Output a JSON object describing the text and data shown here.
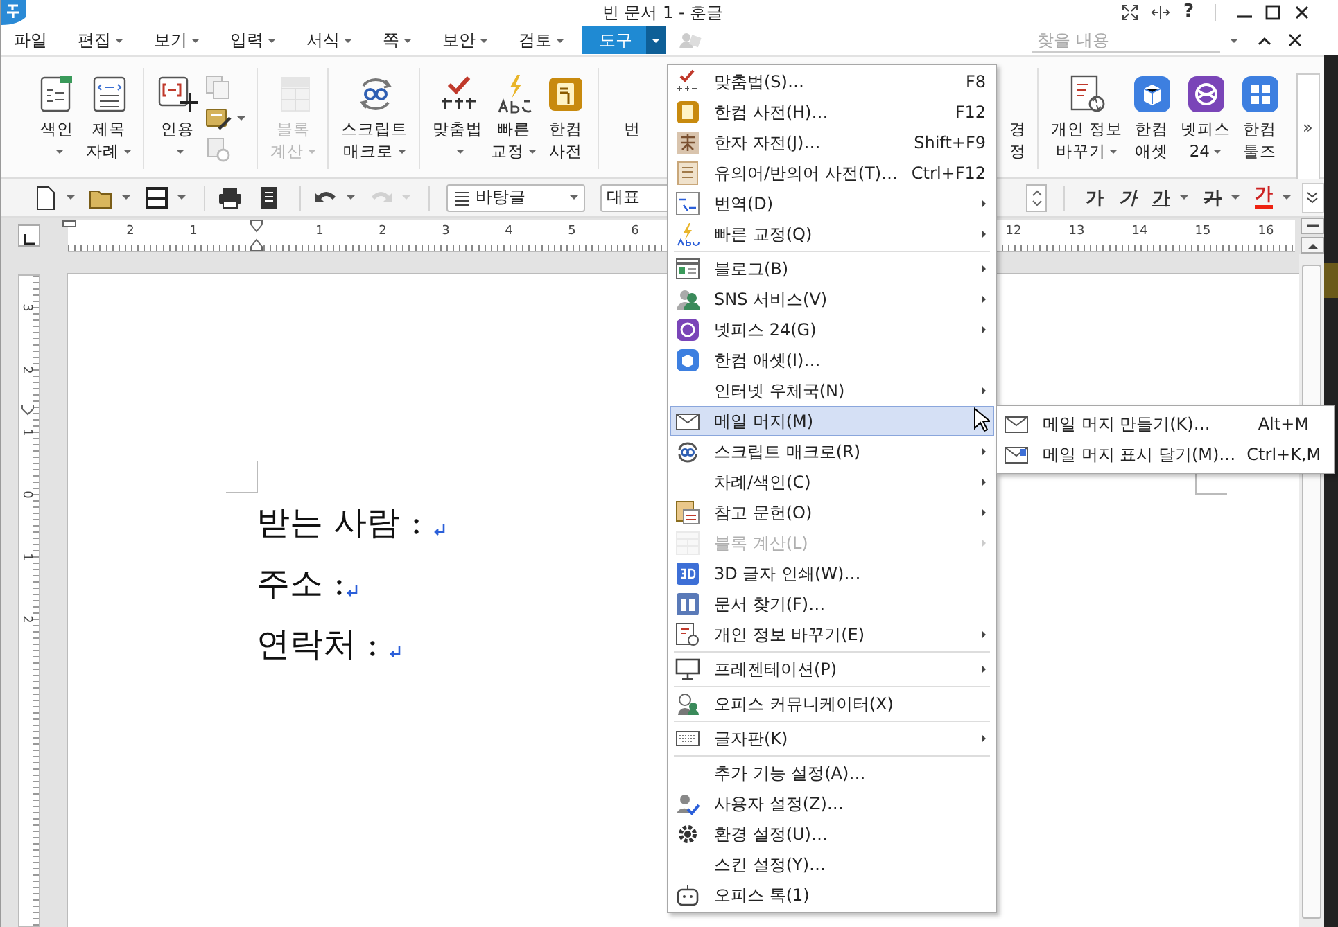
{
  "window": {
    "title": "빈 문서 1 - 훈글",
    "help_label": "?"
  },
  "menubar": {
    "items": [
      {
        "label": "파일",
        "dropdown": false,
        "selected": false
      },
      {
        "label": "편집",
        "dropdown": true,
        "selected": false
      },
      {
        "label": "보기",
        "dropdown": true,
        "selected": false
      },
      {
        "label": "입력",
        "dropdown": true,
        "selected": false
      },
      {
        "label": "서식",
        "dropdown": true,
        "selected": false
      },
      {
        "label": "쪽",
        "dropdown": true,
        "selected": false
      },
      {
        "label": "보안",
        "dropdown": true,
        "selected": false
      },
      {
        "label": "검토",
        "dropdown": true,
        "selected": false
      },
      {
        "label": "도구",
        "dropdown": true,
        "selected": true
      }
    ],
    "search": {
      "placeholder": "찾을 내용"
    }
  },
  "ribbon": {
    "left": [
      {
        "kind": "large",
        "label": [
          "색인"
        ],
        "dropdown": true,
        "disabled": false,
        "separator_after": false
      },
      {
        "kind": "large",
        "label": [
          "제목",
          "자례"
        ],
        "dropdown": true,
        "disabled": false,
        "separator_after": true
      },
      {
        "kind": "large",
        "label": [
          "인용"
        ],
        "dropdown": true,
        "disabled": false,
        "separator_after": false
      },
      {
        "kind": "stack",
        "dropdown": true,
        "disabled": false,
        "separator_after": true
      },
      {
        "kind": "large",
        "label": [
          "블록",
          "계산"
        ],
        "dropdown": true,
        "disabled": true,
        "separator_after": true
      },
      {
        "kind": "large",
        "label": [
          "스크립트",
          "매크로"
        ],
        "dropdown": true,
        "disabled": false,
        "separator_after": true
      },
      {
        "kind": "large",
        "label": [
          "맞춤법"
        ],
        "dropdown": true,
        "disabled": false,
        "separator_after": false
      },
      {
        "kind": "large",
        "label": [
          "빠른",
          "교정"
        ],
        "dropdown": true,
        "disabled": false,
        "separator_after": false
      },
      {
        "kind": "large",
        "label": [
          "한컴",
          "사전"
        ],
        "dropdown": false,
        "disabled": false,
        "separator_after": true
      },
      {
        "kind": "large",
        "label": [
          "번"
        ],
        "dropdown": false,
        "disabled": false
      }
    ],
    "right": [
      {
        "kind": "large",
        "label": [
          "경",
          "정"
        ],
        "dropdown": false,
        "disabled": false,
        "separator_after": true
      },
      {
        "kind": "large",
        "label": [
          "개인 정보",
          "바꾸기"
        ],
        "dropdown": true,
        "disabled": false,
        "separator_after": false
      },
      {
        "kind": "large",
        "label": [
          "한컴",
          "애셋"
        ],
        "dropdown": false,
        "disabled": false,
        "separator_after": false
      },
      {
        "kind": "large",
        "label": [
          "넷피스",
          "24"
        ],
        "dropdown": true,
        "disabled": false,
        "separator_after": false
      },
      {
        "kind": "large",
        "label": [
          "한컴",
          "툴즈"
        ],
        "dropdown": false,
        "disabled": false,
        "separator_after": false
      }
    ],
    "overflow": "»"
  },
  "toolbar": {
    "buttons": [
      {
        "kind": "new",
        "dropdown": true,
        "disabled": false
      },
      {
        "kind": "open",
        "dropdown": true,
        "disabled": false
      },
      {
        "kind": "save",
        "dropdown": true,
        "disabled": false
      },
      {
        "kind": "print",
        "dropdown": false,
        "disabled": false
      },
      {
        "kind": "preview",
        "dropdown": false,
        "disabled": false
      },
      {
        "kind": "undo",
        "dropdown": true,
        "disabled": false
      },
      {
        "kind": "redo",
        "dropdown": true,
        "disabled": true
      }
    ],
    "style_select": {
      "value": "바탕글"
    },
    "font_select": {
      "value": "대표"
    },
    "format_buttons": [
      {
        "kind": "bold",
        "label": "가",
        "dropdown": false
      },
      {
        "kind": "italic",
        "label": "가",
        "dropdown": false
      },
      {
        "kind": "underline",
        "label": "가",
        "dropdown": true
      },
      {
        "kind": "strike",
        "label": "가",
        "dropdown": true
      },
      {
        "kind": "color",
        "label": "가",
        "dropdown": true
      }
    ]
  },
  "ruler": {
    "left_numbers": [
      "2",
      "1"
    ],
    "right_numbers": [
      "1",
      "2",
      "3",
      "4",
      "5",
      "6"
    ],
    "far_numbers": [
      "12",
      "13",
      "14",
      "15",
      "16"
    ],
    "vertical_numbers": [
      "3",
      "2",
      "1",
      "0",
      "1",
      "2"
    ]
  },
  "document": {
    "lines": [
      "받는 사람 : ",
      "주소 :",
      "연락처 : "
    ]
  },
  "menu": {
    "items": [
      {
        "label": "맞춤법(S)…",
        "shortcut": "F8",
        "arrow": false,
        "selected": false,
        "disabled": false,
        "separator_after": false
      },
      {
        "label": "한컴 사전(H)…",
        "shortcut": "F12",
        "arrow": false,
        "selected": false,
        "disabled": false,
        "separator_after": false
      },
      {
        "label": "한자 자전(J)…",
        "shortcut": "Shift+F9",
        "arrow": false,
        "selected": false,
        "disabled": false,
        "separator_after": false
      },
      {
        "label": "유의어/반의어 사전(T)…",
        "shortcut": "Ctrl+F12",
        "arrow": false,
        "selected": false,
        "disabled": false,
        "separator_after": false
      },
      {
        "label": "번역(D)",
        "arrow": true,
        "selected": false,
        "disabled": false,
        "separator_after": false
      },
      {
        "label": "빠른 교정(Q)",
        "arrow": true,
        "selected": false,
        "disabled": false,
        "separator_after": true
      },
      {
        "label": "블로그(B)",
        "arrow": true,
        "selected": false,
        "disabled": false,
        "separator_after": false
      },
      {
        "label": "SNS 서비스(V)",
        "arrow": true,
        "selected": false,
        "disabled": false,
        "separator_after": false
      },
      {
        "label": "넷피스 24(G)",
        "arrow": true,
        "selected": false,
        "disabled": false,
        "separator_after": false
      },
      {
        "label": "한컴 애셋(I)…",
        "arrow": false,
        "selected": false,
        "disabled": false,
        "separator_after": false
      },
      {
        "label": "인터넷 우체국(N)",
        "arrow": true,
        "selected": false,
        "disabled": false,
        "separator_after": false
      },
      {
        "label": "메일 머지(M)",
        "arrow": true,
        "selected": true,
        "disabled": false,
        "separator_after": false,
        "submenu": [
          {
            "label": "메일 머지 만들기(K)…",
            "shortcut": "Alt+M",
            "selected": false
          },
          {
            "label": "메일 머지 표시 달기(M)…",
            "shortcut": "Ctrl+K,M",
            "selected": false
          }
        ]
      },
      {
        "label": "스크립트 매크로(R)",
        "arrow": true,
        "selected": false,
        "disabled": false,
        "separator_after": false
      },
      {
        "label": "차례/색인(C)",
        "arrow": true,
        "selected": false,
        "disabled": false,
        "separator_after": false
      },
      {
        "label": "참고 문헌(O)",
        "arrow": true,
        "selected": false,
        "disabled": false,
        "separator_after": false
      },
      {
        "label": "블록 계산(L)",
        "arrow": true,
        "selected": false,
        "disabled": true,
        "separator_after": false
      },
      {
        "label": "3D 글자 인쇄(W)…",
        "arrow": false,
        "selected": false,
        "disabled": false,
        "separator_after": false
      },
      {
        "label": "문서 찾기(F)…",
        "arrow": false,
        "selected": false,
        "disabled": false,
        "separator_after": false
      },
      {
        "label": "개인 정보 바꾸기(E)",
        "arrow": true,
        "selected": false,
        "disabled": false,
        "separator_after": true
      },
      {
        "label": "프레젠테이션(P)",
        "arrow": true,
        "selected": false,
        "disabled": false,
        "separator_after": true
      },
      {
        "label": "오피스 커뮤니케이터(X)",
        "arrow": false,
        "selected": false,
        "disabled": false,
        "separator_after": true
      },
      {
        "label": "글자판(K)",
        "arrow": true,
        "selected": false,
        "disabled": false,
        "separator_after": true
      },
      {
        "label": "추가 기능 설정(A)…",
        "arrow": false,
        "selected": false,
        "disabled": false,
        "separator_after": false
      },
      {
        "label": "사용자 설정(Z)…",
        "arrow": false,
        "selected": false,
        "disabled": false,
        "separator_after": false
      },
      {
        "label": "환경 설정(U)…",
        "arrow": false,
        "selected": false,
        "disabled": false,
        "separator_after": false
      },
      {
        "label": "스킨 설정(Y)…",
        "arrow": false,
        "selected": false,
        "disabled": false,
        "separator_after": false
      },
      {
        "label": "오피스 톡(1)",
        "arrow": false,
        "selected": false,
        "disabled": false,
        "separator_after": false
      }
    ]
  }
}
